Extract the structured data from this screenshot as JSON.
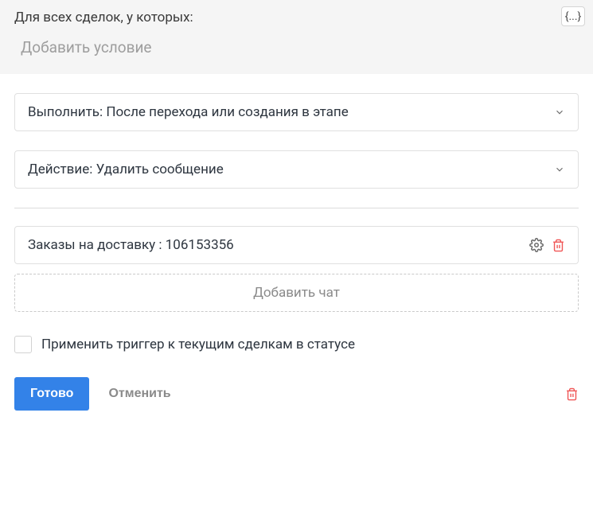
{
  "header": {
    "prompt_label": "Для всех сделок, у которых:",
    "add_condition_label": "Добавить условие",
    "json_btn_label": "{...}"
  },
  "execute": {
    "label": "Выполнить: После перехода или создания в этапе"
  },
  "action": {
    "label": "Действие: Удалить сообщение"
  },
  "chat": {
    "item_label": "Заказы на доставку : 106153356",
    "add_label": "Добавить чат"
  },
  "apply_trigger_label": "Применить триггер к текущим сделкам в статусе",
  "buttons": {
    "done": "Готово",
    "cancel": "Отменить"
  }
}
